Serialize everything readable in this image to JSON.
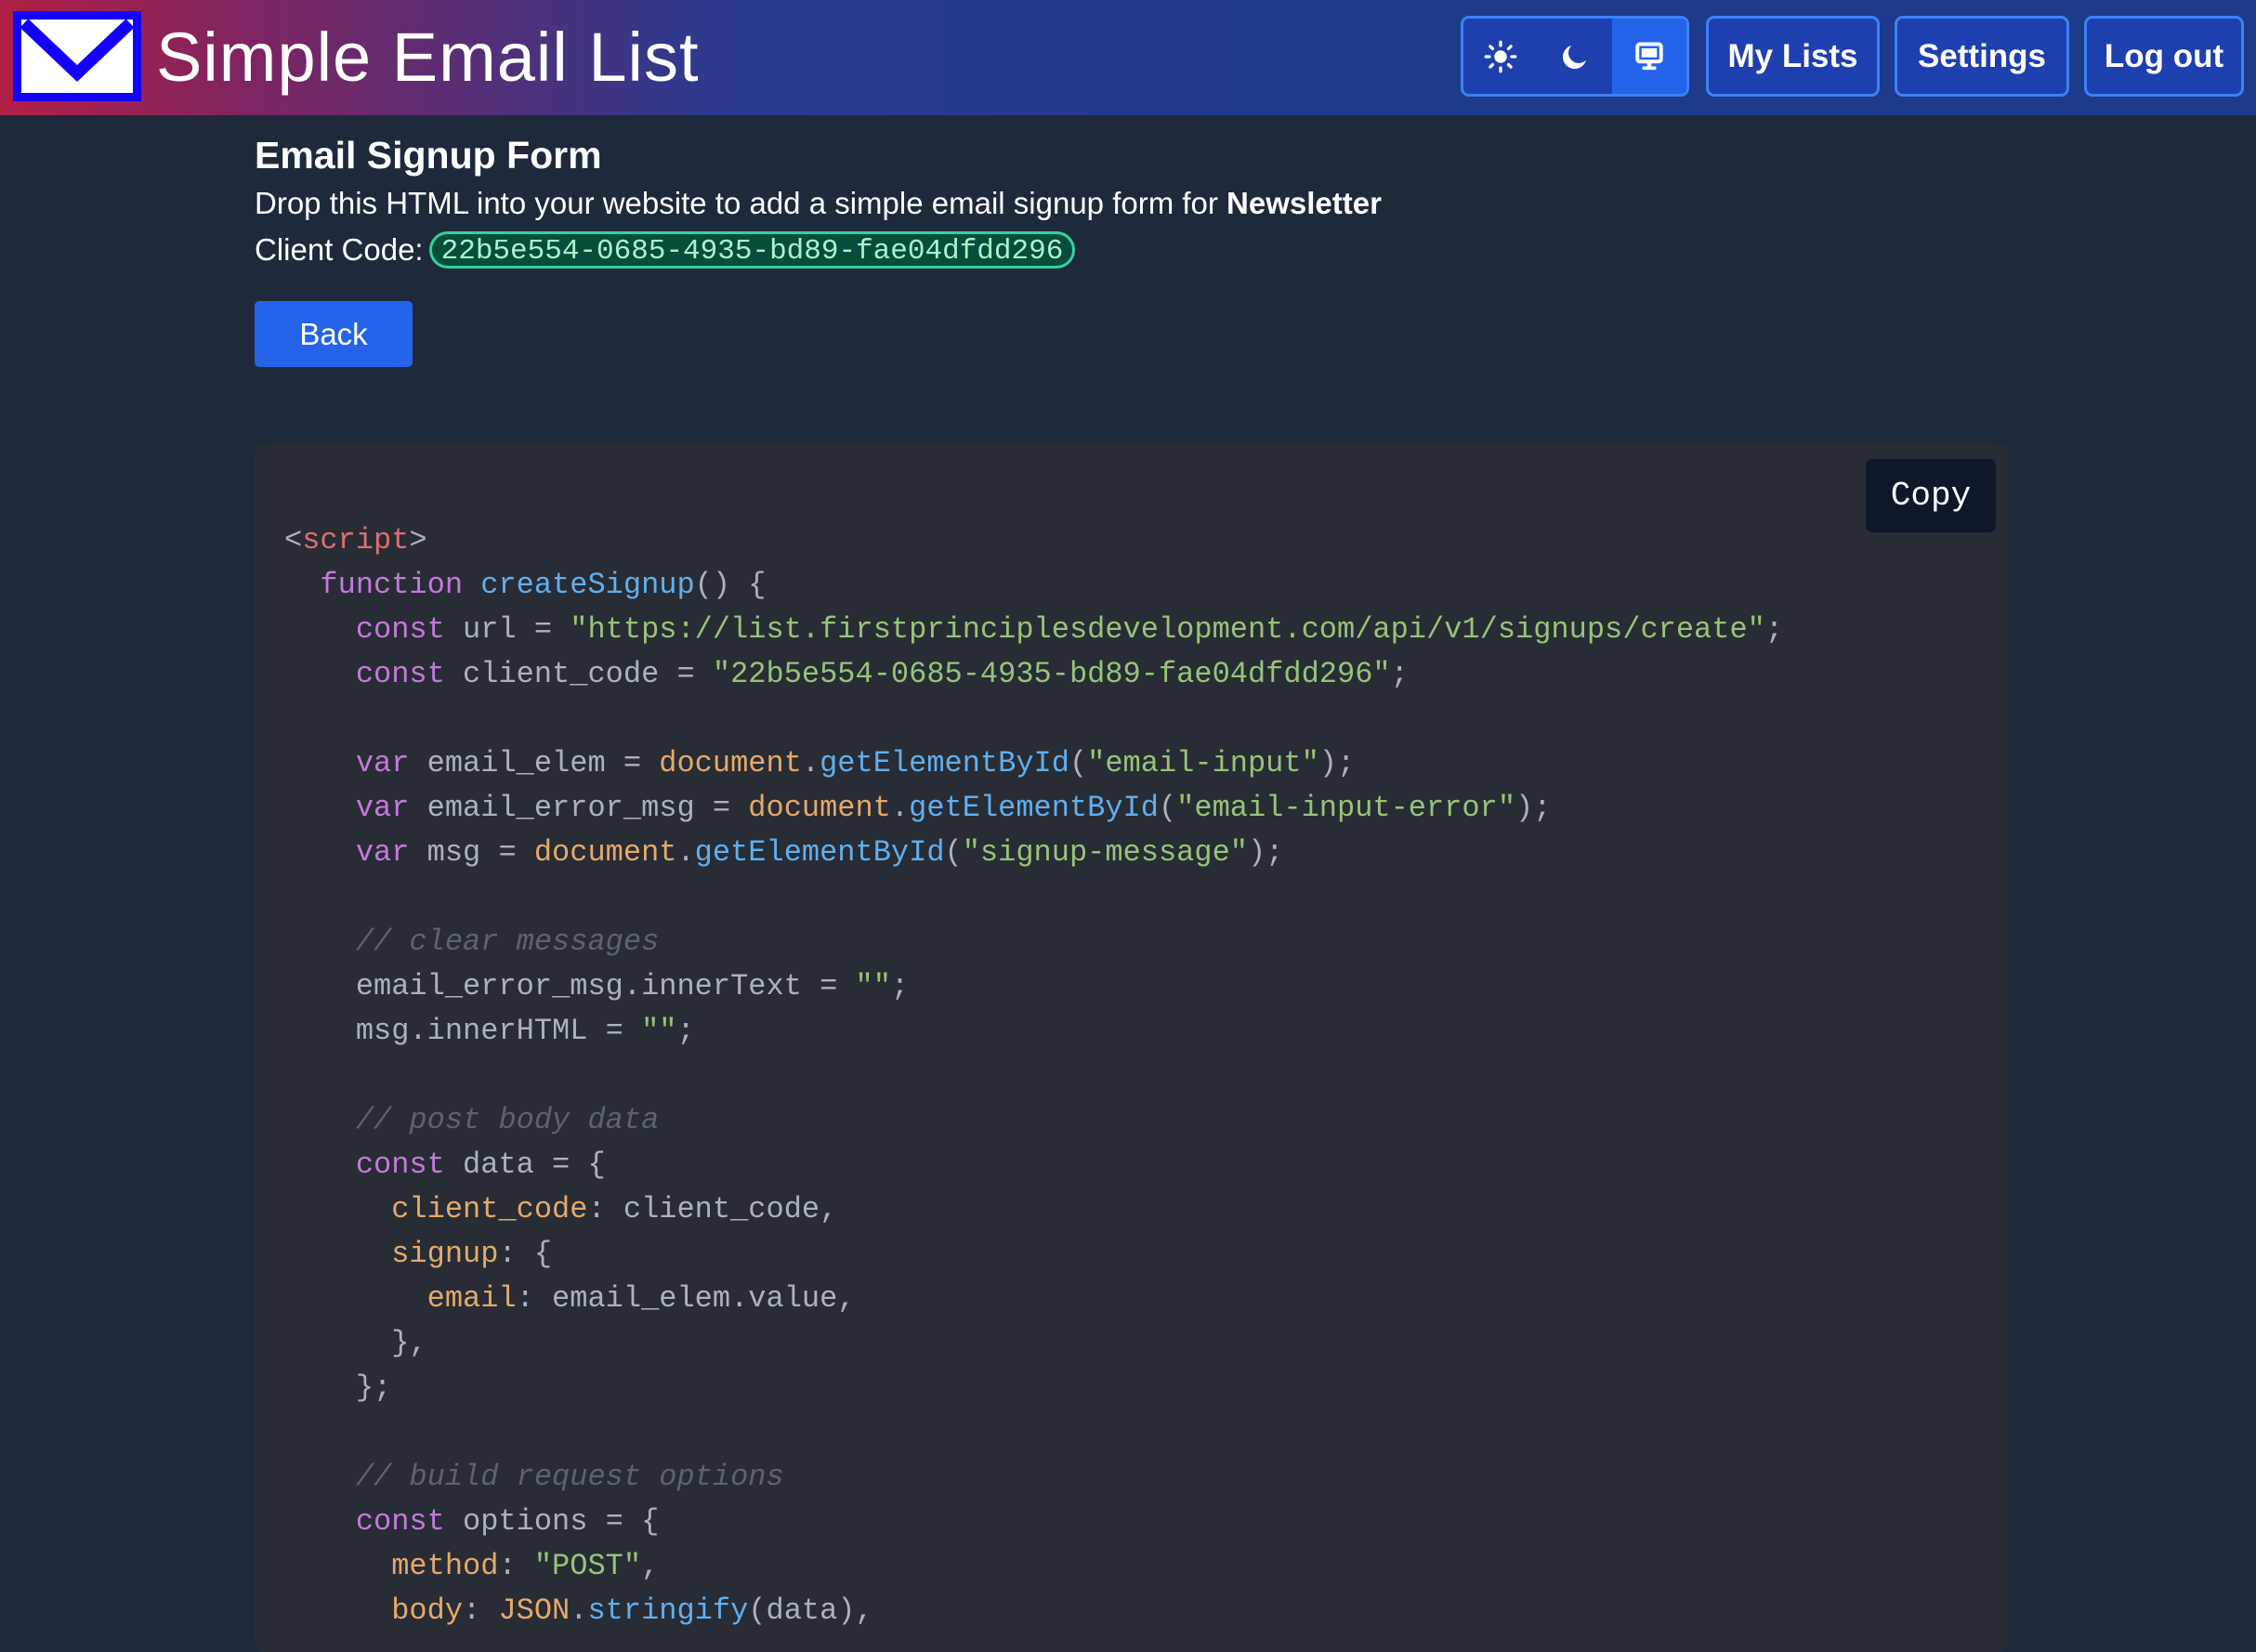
{
  "header": {
    "app_title": "Simple Email List",
    "logo_icon": "envelope-icon",
    "theme_toggle": {
      "options": [
        {
          "name": "light",
          "icon": "sun-icon"
        },
        {
          "name": "dark",
          "icon": "moon-icon"
        },
        {
          "name": "system",
          "icon": "monitor-icon"
        }
      ],
      "selected": "system"
    },
    "nav": {
      "my_lists": "My Lists",
      "settings": "Settings",
      "log_out": "Log out"
    }
  },
  "page": {
    "title": "Email Signup Form",
    "description_prefix": "Drop this HTML into your website to add a simple email signup form for ",
    "list_name": "Newsletter",
    "client_code_label": "Client Code:",
    "client_code": "22b5e554-0685-4935-bd89-fae04dfdd296",
    "back_label": "Back"
  },
  "code_block": {
    "copy_label": "Copy",
    "lines": [
      [
        [
          "t-txt",
          "<"
        ],
        [
          "t-tag",
          "script"
        ],
        [
          "t-txt",
          ">"
        ]
      ],
      [
        [
          "t-txt",
          "  "
        ],
        [
          "t-kw",
          "function"
        ],
        [
          "t-txt",
          " "
        ],
        [
          "t-fn",
          "createSignup"
        ],
        [
          "t-txt",
          "() {"
        ]
      ],
      [
        [
          "t-txt",
          "    "
        ],
        [
          "t-kw",
          "const"
        ],
        [
          "t-txt",
          " url = "
        ],
        [
          "t-str",
          "\"https://list.firstprinciplesdevelopment.com/api/v1/signups/create\""
        ],
        [
          "t-txt",
          ";"
        ]
      ],
      [
        [
          "t-txt",
          "    "
        ],
        [
          "t-kw",
          "const"
        ],
        [
          "t-txt",
          " client_code = "
        ],
        [
          "t-str",
          "\"22b5e554-0685-4935-bd89-fae04dfdd296\""
        ],
        [
          "t-txt",
          ";"
        ]
      ],
      [],
      [
        [
          "t-txt",
          "    "
        ],
        [
          "t-kw",
          "var"
        ],
        [
          "t-txt",
          " email_elem = "
        ],
        [
          "t-obj",
          "document"
        ],
        [
          "t-txt",
          "."
        ],
        [
          "t-fn",
          "getElementById"
        ],
        [
          "t-txt",
          "("
        ],
        [
          "t-str",
          "\"email-input\""
        ],
        [
          "t-txt",
          ");"
        ]
      ],
      [
        [
          "t-txt",
          "    "
        ],
        [
          "t-kw",
          "var"
        ],
        [
          "t-txt",
          " email_error_msg = "
        ],
        [
          "t-obj",
          "document"
        ],
        [
          "t-txt",
          "."
        ],
        [
          "t-fn",
          "getElementById"
        ],
        [
          "t-txt",
          "("
        ],
        [
          "t-str",
          "\"email-input-error\""
        ],
        [
          "t-txt",
          ");"
        ]
      ],
      [
        [
          "t-txt",
          "    "
        ],
        [
          "t-kw",
          "var"
        ],
        [
          "t-txt",
          " msg = "
        ],
        [
          "t-obj",
          "document"
        ],
        [
          "t-txt",
          "."
        ],
        [
          "t-fn",
          "getElementById"
        ],
        [
          "t-txt",
          "("
        ],
        [
          "t-str",
          "\"signup-message\""
        ],
        [
          "t-txt",
          ");"
        ]
      ],
      [],
      [
        [
          "t-txt",
          "    "
        ],
        [
          "t-com",
          "// clear messages"
        ]
      ],
      [
        [
          "t-txt",
          "    email_error_msg.innerText = "
        ],
        [
          "t-str",
          "\"\""
        ],
        [
          "t-txt",
          ";"
        ]
      ],
      [
        [
          "t-txt",
          "    msg.innerHTML = "
        ],
        [
          "t-str",
          "\"\""
        ],
        [
          "t-txt",
          ";"
        ]
      ],
      [],
      [
        [
          "t-txt",
          "    "
        ],
        [
          "t-com",
          "// post body data"
        ]
      ],
      [
        [
          "t-txt",
          "    "
        ],
        [
          "t-kw",
          "const"
        ],
        [
          "t-txt",
          " data = {"
        ]
      ],
      [
        [
          "t-txt",
          "      "
        ],
        [
          "t-obj",
          "client_code"
        ],
        [
          "t-txt",
          ": client_code,"
        ]
      ],
      [
        [
          "t-txt",
          "      "
        ],
        [
          "t-obj",
          "signup"
        ],
        [
          "t-txt",
          ": {"
        ]
      ],
      [
        [
          "t-txt",
          "        "
        ],
        [
          "t-obj",
          "email"
        ],
        [
          "t-txt",
          ": email_elem.value,"
        ]
      ],
      [
        [
          "t-txt",
          "      },"
        ]
      ],
      [
        [
          "t-txt",
          "    };"
        ]
      ],
      [],
      [
        [
          "t-txt",
          "    "
        ],
        [
          "t-com",
          "// build request options"
        ]
      ],
      [
        [
          "t-txt",
          "    "
        ],
        [
          "t-kw",
          "const"
        ],
        [
          "t-txt",
          " options = {"
        ]
      ],
      [
        [
          "t-txt",
          "      "
        ],
        [
          "t-obj",
          "method"
        ],
        [
          "t-txt",
          ": "
        ],
        [
          "t-str",
          "\"POST\""
        ],
        [
          "t-txt",
          ","
        ]
      ],
      [
        [
          "t-txt",
          "      "
        ],
        [
          "t-obj",
          "body"
        ],
        [
          "t-txt",
          ": "
        ],
        [
          "t-obj",
          "JSON"
        ],
        [
          "t-txt",
          "."
        ],
        [
          "t-fn",
          "stringify"
        ],
        [
          "t-txt",
          "(data),"
        ]
      ]
    ]
  },
  "colors": {
    "background": "#1e293b",
    "header_blue": "#1e3a8a",
    "accent": "#2563eb",
    "badge_border": "#34d399",
    "code_background": "#282c34"
  }
}
